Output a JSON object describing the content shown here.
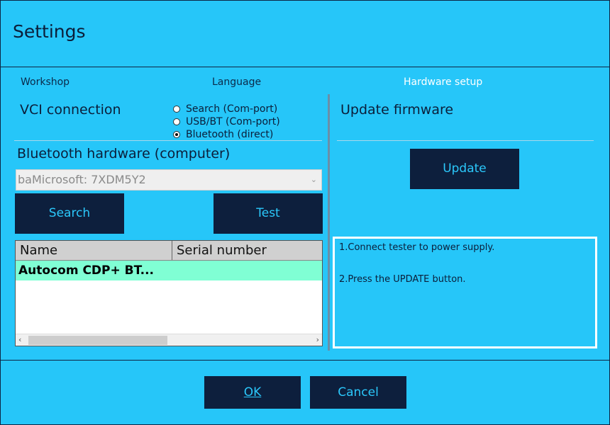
{
  "window": {
    "title": "Settings"
  },
  "tabs": [
    {
      "label": "Workshop",
      "active": false
    },
    {
      "label": "Language",
      "active": false
    },
    {
      "label": "Hardware setup",
      "active": true
    }
  ],
  "vci": {
    "title": "VCI connection",
    "options": [
      {
        "label": "Search (Com-port)",
        "checked": false
      },
      {
        "label": "USB/BT (Com-port)",
        "checked": false
      },
      {
        "label": "Bluetooth (direct)",
        "checked": true
      }
    ]
  },
  "bluetooth": {
    "title": "Bluetooth hardware (computer)",
    "selected_device": "baMicrosoft: 7XDM5Y2",
    "search_label": "Search",
    "test_label": "Test",
    "table": {
      "columns": [
        "Name",
        "Serial number"
      ],
      "rows": [
        {
          "name": "Autocom CDP+ BT...",
          "serial": ""
        }
      ]
    }
  },
  "firmware": {
    "title": "Update firmware",
    "update_label": "Update",
    "instructions": [
      "1.Connect tester to power supply.",
      "2.Press the UPDATE button."
    ]
  },
  "footer": {
    "ok_label": "OK",
    "cancel_label": "Cancel"
  },
  "colors": {
    "background": "#26c6f9",
    "button": "#0d1f3d",
    "button_text": "#2bc8fb",
    "selected_row": "#80ffd4"
  }
}
